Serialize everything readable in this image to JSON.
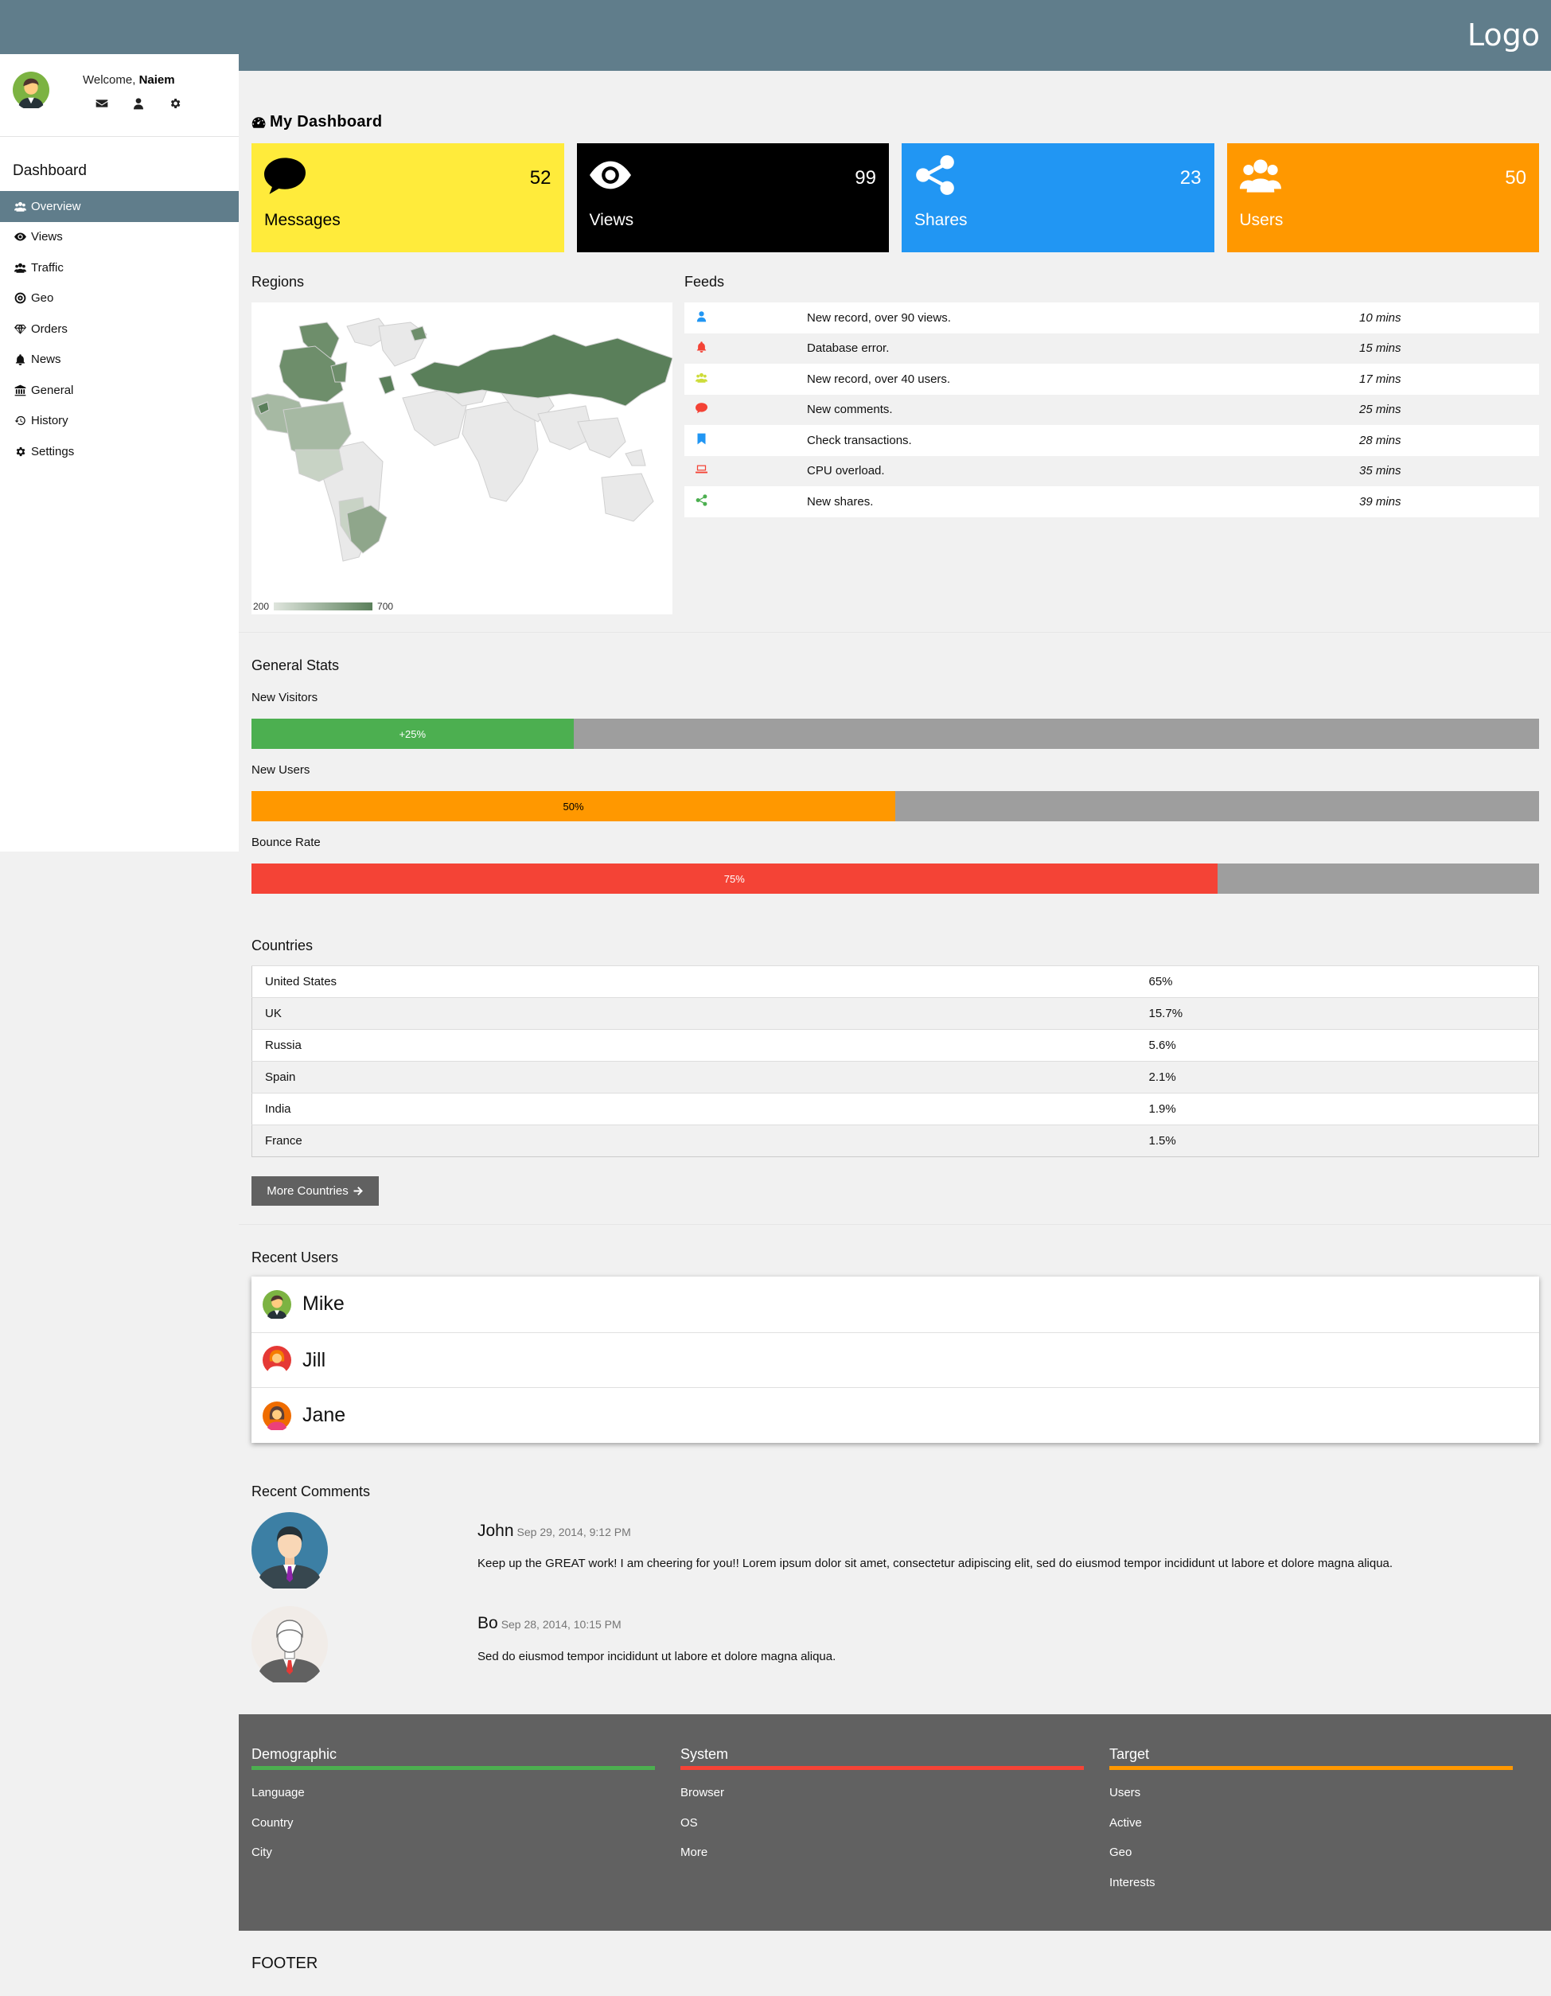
{
  "header": {
    "logo": "Logo"
  },
  "sidebar": {
    "welcome_prefix": "Welcome, ",
    "username": "Naiem",
    "section_title": "Dashboard",
    "items": [
      {
        "label": "Overview",
        "icon": "users-icon"
      },
      {
        "label": "Views",
        "icon": "eye-icon"
      },
      {
        "label": "Traffic",
        "icon": "users-icon"
      },
      {
        "label": "Geo",
        "icon": "bullseye-icon"
      },
      {
        "label": "Orders",
        "icon": "diamond-icon"
      },
      {
        "label": "News",
        "icon": "bell-icon"
      },
      {
        "label": "General",
        "icon": "bank-icon"
      },
      {
        "label": "History",
        "icon": "history-icon"
      },
      {
        "label": "Settings",
        "icon": "gear-icon"
      }
    ]
  },
  "dashboard": {
    "title": "My Dashboard"
  },
  "cards": [
    {
      "label": "Messages",
      "value": "52",
      "color": "#ffeb3b",
      "text_color": "#000000"
    },
    {
      "label": "Views",
      "value": "99",
      "color": "#000000",
      "text_color": "#ffffff"
    },
    {
      "label": "Shares",
      "value": "23",
      "color": "#2196f3",
      "text_color": "#ffffff"
    },
    {
      "label": "Users",
      "value": "50",
      "color": "#ff9800",
      "text_color": "#ffffff"
    }
  ],
  "regions": {
    "title": "Regions",
    "legend_min": "200",
    "legend_max": "700"
  },
  "feeds": {
    "title": "Feeds",
    "rows": [
      {
        "icon": "user-icon",
        "color": "#2196f3",
        "text": "New record, over 90 views.",
        "time": "10 mins"
      },
      {
        "icon": "bell-icon",
        "color": "#f44336",
        "text": "Database error.",
        "time": "15 mins"
      },
      {
        "icon": "users-icon",
        "color": "#cddc39",
        "text": "New record, over 40 users.",
        "time": "17 mins"
      },
      {
        "icon": "comment-icon",
        "color": "#f44336",
        "text": "New comments.",
        "time": "25 mins"
      },
      {
        "icon": "bookmark-icon",
        "color": "#2196f3",
        "text": "Check transactions.",
        "time": "28 mins"
      },
      {
        "icon": "laptop-icon",
        "color": "#f44336",
        "text": "CPU overload.",
        "time": "35 mins"
      },
      {
        "icon": "share-icon",
        "color": "#4caf50",
        "text": "New shares.",
        "time": "39 mins"
      }
    ]
  },
  "general_stats": {
    "title": "General Stats",
    "bars": [
      {
        "label": "New Visitors",
        "value_text": "+25%",
        "fraction": 0.25,
        "color": "#4caf50",
        "text_color": "#ffffff"
      },
      {
        "label": "New Users",
        "value_text": "50%",
        "fraction": 0.5,
        "color": "#ff9800",
        "text_color": "#000000"
      },
      {
        "label": "Bounce Rate",
        "value_text": "75%",
        "fraction": 0.75,
        "color": "#f44336",
        "text_color": "#ffffff"
      }
    ]
  },
  "countries": {
    "title": "Countries",
    "rows": [
      {
        "name": "United States",
        "value": "65%"
      },
      {
        "name": "UK",
        "value": "15.7%"
      },
      {
        "name": "Russia",
        "value": "5.6%"
      },
      {
        "name": "Spain",
        "value": "2.1%"
      },
      {
        "name": "India",
        "value": "1.9%"
      },
      {
        "name": "France",
        "value": "1.5%"
      }
    ],
    "more_label": "More Countries"
  },
  "recent_users": {
    "title": "Recent Users",
    "users": [
      {
        "name": "Mike"
      },
      {
        "name": "Jill"
      },
      {
        "name": "Jane"
      }
    ]
  },
  "recent_comments": {
    "title": "Recent Comments",
    "comments": [
      {
        "name": "John",
        "date": "Sep 29, 2014, 9:12 PM",
        "text": "Keep up the GREAT work! I am cheering for you!! Lorem ipsum dolor sit amet, consectetur adipiscing elit, sed do eiusmod tempor incididunt ut labore et dolore magna aliqua."
      },
      {
        "name": "Bo",
        "date": "Sep 28, 2014, 10:15 PM",
        "text": "Sed do eiusmod tempor incididunt ut labore et dolore magna aliqua."
      }
    ]
  },
  "footer": {
    "columns": [
      {
        "title": "Demographic",
        "color": "#4caf50",
        "links": [
          "Language",
          "Country",
          "City"
        ]
      },
      {
        "title": "System",
        "color": "#f44336",
        "links": [
          "Browser",
          "OS",
          "More"
        ]
      },
      {
        "title": "Target",
        "color": "#ff9800",
        "links": [
          "Users",
          "Active",
          "Geo",
          "Interests"
        ]
      }
    ],
    "bottom_text": "FOOTER"
  }
}
